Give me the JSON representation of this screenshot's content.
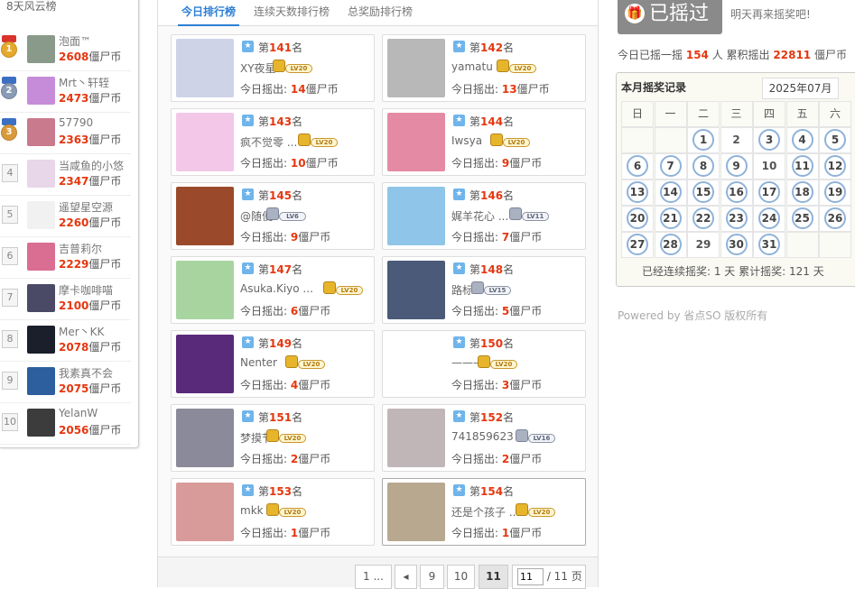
{
  "left_title": "8天风云榜",
  "leaders": [
    {
      "rank": "1",
      "name": "泡面™",
      "coins": "2608",
      "unit": "僵尸币",
      "medal": "gold",
      "bg": "#8a9a8a"
    },
    {
      "rank": "2",
      "name": "Mrt丶轩轾",
      "coins": "2473",
      "unit": "僵尸币",
      "medal": "silver",
      "bg": "#c68cd9"
    },
    {
      "rank": "3",
      "name": "57790",
      "coins": "2363",
      "unit": "僵尸币",
      "medal": "bronze",
      "bg": "#c97a8d"
    },
    {
      "rank": "4",
      "name": "当咸鱼的小悠",
      "coins": "2347",
      "unit": "僵尸币",
      "medal": "",
      "bg": "#e8d6e9"
    },
    {
      "rank": "5",
      "name": "遥望星空源",
      "coins": "2260",
      "unit": "僵尸币",
      "medal": "",
      "bg": "#f1f1f1"
    },
    {
      "rank": "6",
      "name": "吉普莉尔",
      "coins": "2229",
      "unit": "僵尸币",
      "medal": "",
      "bg": "#d96d92"
    },
    {
      "rank": "7",
      "name": "摩卡咖啡喵",
      "coins": "2100",
      "unit": "僵尸币",
      "medal": "",
      "bg": "#4b4a66"
    },
    {
      "rank": "8",
      "name": "Mer丶KK",
      "coins": "2078",
      "unit": "僵尸币",
      "medal": "",
      "bg": "#1b1e2b"
    },
    {
      "rank": "9",
      "name": "我素真不会",
      "coins": "2075",
      "unit": "僵尸币",
      "medal": "",
      "bg": "#2d5e9e"
    },
    {
      "rank": "10",
      "name": "YelanW",
      "coins": "2056",
      "unit": "僵尸币",
      "medal": "",
      "bg": "#3c3c3c"
    }
  ],
  "tabs": [
    "今日排行榜",
    "连续天数排行榜",
    "总奖励排行榜"
  ],
  "rank_prefix": "第",
  "rank_suffix": "名",
  "today_label": "今日摇出:",
  "coin_unit": "僵尸币",
  "cards": [
    {
      "rank": "141",
      "name": "XY夜星",
      "level": "LV20",
      "tier": "gold",
      "amount": "14",
      "bg": "#cfd3e8"
    },
    {
      "rank": "142",
      "name": "yamatu",
      "level": "LV20",
      "tier": "gold",
      "amount": "13",
      "bg": "#b8b8b8"
    },
    {
      "rank": "143",
      "name": "疯不觉零 ...",
      "level": "LV20",
      "tier": "gold",
      "amount": "10",
      "bg": "#f2c7e8"
    },
    {
      "rank": "144",
      "name": "Iwsya",
      "level": "LV20",
      "tier": "gold",
      "amount": "9",
      "bg": "#e58aa5"
    },
    {
      "rank": "145",
      "name": "@随便",
      "level": "LV6",
      "tier": "silver",
      "amount": "9",
      "bg": "#9a4a2a"
    },
    {
      "rank": "146",
      "name": "娓羊花心 ...",
      "level": "LV11",
      "tier": "silver",
      "amount": "7",
      "bg": "#8fc5e8"
    },
    {
      "rank": "147",
      "name": "Asuka.Kiyo ...",
      "level": "LV20",
      "tier": "gold",
      "amount": "6",
      "bg": "#a8d4a0"
    },
    {
      "rank": "148",
      "name": "路标",
      "level": "LV15",
      "tier": "silver",
      "amount": "5",
      "bg": "#4a5a78"
    },
    {
      "rank": "149",
      "name": "Nenter",
      "level": "LV20",
      "tier": "gold",
      "amount": "4",
      "bg": "#5a2a7a"
    },
    {
      "rank": "150",
      "name": "———",
      "level": "LV20",
      "tier": "gold",
      "amount": "3",
      "bg": "#ffffff"
    },
    {
      "rank": "151",
      "name": "梦摸节",
      "level": "LV20",
      "tier": "gold",
      "amount": "2",
      "bg": "#8a8a9a"
    },
    {
      "rank": "152",
      "name": "741859623",
      "level": "LV16",
      "tier": "silver",
      "amount": "2",
      "bg": "#c0b6b8"
    },
    {
      "rank": "153",
      "name": "mkk",
      "level": "LV20",
      "tier": "gold",
      "amount": "1",
      "bg": "#d99a9a"
    },
    {
      "rank": "154",
      "name": "还是个孩子 ...",
      "level": "LV20",
      "tier": "gold",
      "amount": "1",
      "bg": "#b8a890"
    }
  ],
  "pager": {
    "first": "1 ...",
    "prev": "◂",
    "p9": "9",
    "p10": "10",
    "p11": "11",
    "input": "11",
    "total": "/ 11 页"
  },
  "shake_button": "已摇过",
  "gift_icon": "🎁",
  "tomorrow": "明天再来摇奖吧!",
  "stats": {
    "pre": "今日已摇一摇",
    "count": "154",
    "mid": "人 累积摇出",
    "total": "22811",
    "unit": "僵尸币"
  },
  "calendar": {
    "title": "本月摇奖记录",
    "month": "2025年07月",
    "weekdays": [
      "日",
      "一",
      "二",
      "三",
      "四",
      "五",
      "六"
    ],
    "days": [
      {
        "d": "",
        "s": false
      },
      {
        "d": "",
        "s": false
      },
      {
        "d": "1",
        "s": true
      },
      {
        "d": "2",
        "s": false
      },
      {
        "d": "3",
        "s": true
      },
      {
        "d": "4",
        "s": true
      },
      {
        "d": "5",
        "s": true
      },
      {
        "d": "6",
        "s": true
      },
      {
        "d": "7",
        "s": true
      },
      {
        "d": "8",
        "s": true
      },
      {
        "d": "9",
        "s": true
      },
      {
        "d": "10",
        "s": false
      },
      {
        "d": "11",
        "s": true
      },
      {
        "d": "12",
        "s": true
      },
      {
        "d": "13",
        "s": true
      },
      {
        "d": "14",
        "s": true
      },
      {
        "d": "15",
        "s": true
      },
      {
        "d": "16",
        "s": true
      },
      {
        "d": "17",
        "s": true
      },
      {
        "d": "18",
        "s": true
      },
      {
        "d": "19",
        "s": true
      },
      {
        "d": "20",
        "s": true
      },
      {
        "d": "21",
        "s": true
      },
      {
        "d": "22",
        "s": true
      },
      {
        "d": "23",
        "s": true
      },
      {
        "d": "24",
        "s": true
      },
      {
        "d": "25",
        "s": true
      },
      {
        "d": "26",
        "s": true
      },
      {
        "d": "27",
        "s": true
      },
      {
        "d": "28",
        "s": true
      },
      {
        "d": "29",
        "s": false
      },
      {
        "d": "30",
        "s": true
      },
      {
        "d": "31",
        "s": true
      },
      {
        "d": "",
        "s": false
      },
      {
        "d": "",
        "s": false
      }
    ],
    "footer": "已经连续摇奖: 1 天  累计摇奖: 121 天"
  },
  "powered": "Powered by 省点SO 版权所有",
  "colors": {
    "accent": "#2e7fd6",
    "highlight": "#e5370f"
  }
}
